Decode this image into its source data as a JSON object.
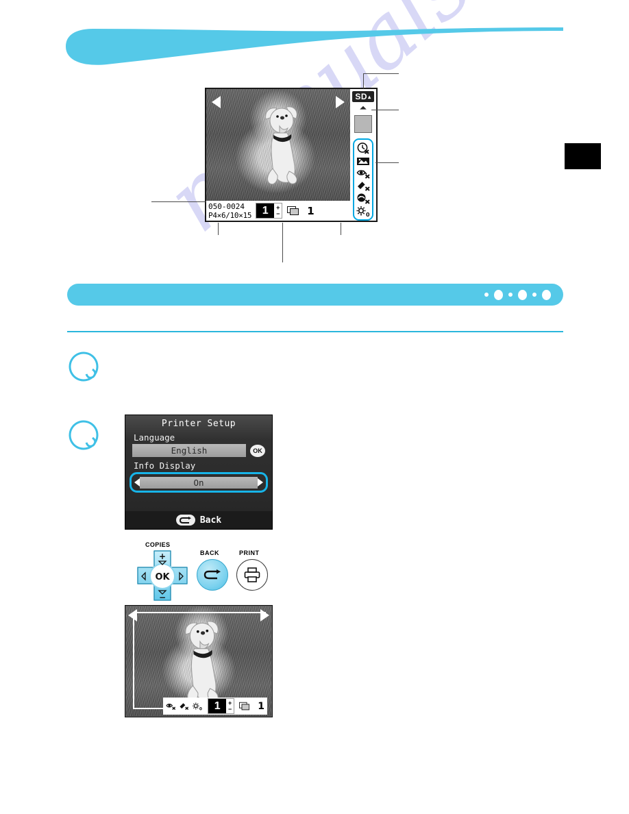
{
  "page": {
    "watermark": "manualshive.com",
    "band_dots": [
      "small",
      "large",
      "small",
      "large",
      "small",
      "large"
    ]
  },
  "lcd_top": {
    "nav_left_icon": "triangle-left-icon",
    "nav_right_icon": "triangle-right-icon",
    "image_id": "050-0024",
    "paper_size": "P4×6/10×15",
    "copies": "1",
    "plus": "+",
    "minus": "−",
    "stack_icon": "print-stack-icon",
    "total_copies": "1",
    "card_badge": "SD",
    "card_badge_mark": "▴",
    "eject_icon": "eject-icon",
    "card_slot_icon": "memory-card-icon",
    "status_icons": [
      {
        "name": "date-print-off-icon",
        "label": "Date print off"
      },
      {
        "name": "image-optimize-icon",
        "label": "Image optimize"
      },
      {
        "name": "red-eye-correction-off-icon",
        "label": "Red-eye correction off"
      },
      {
        "name": "noise-reduction-off-icon",
        "label": "Noise reduction off"
      },
      {
        "name": "face-brighten-off-icon",
        "label": "Face brightener off"
      },
      {
        "name": "brightness-level-icon",
        "label": "Brightness",
        "value": "0"
      }
    ]
  },
  "lcd_menu": {
    "title": "Printer Setup",
    "language_label": "Language",
    "language_value": "English",
    "ok_label": "OK",
    "info_display_label": "Info Display",
    "info_display_value": "On",
    "arrow_left_icon": "triangle-left-icon",
    "arrow_right_icon": "triangle-right-icon",
    "back_label": "Back",
    "back_icon": "return-arrow-icon"
  },
  "buttons": {
    "copies_label": "COPIES",
    "ok_label": "OK",
    "up_plus": "+",
    "down_minus": "−",
    "back_label": "BACK",
    "print_label": "PRINT",
    "back_icon": "return-arrow-icon",
    "print_icon": "printer-icon",
    "dpad_up_icon": "chevron-up-icon",
    "dpad_down_icon": "chevron-down-icon",
    "dpad_left_icon": "chevron-left-icon",
    "dpad_right_icon": "chevron-right-icon"
  },
  "lcd_bottom": {
    "nav_left_icon": "triangle-left-icon",
    "nav_right_icon": "triangle-right-icon",
    "copies": "1",
    "plus": "+",
    "minus": "−",
    "total_copies": "1",
    "stack_icon": "print-stack-icon",
    "status_icons": [
      {
        "name": "red-eye-correction-off-icon",
        "label": "Red-eye correction off"
      },
      {
        "name": "noise-reduction-off-icon",
        "label": "Noise reduction off"
      },
      {
        "name": "brightness-level-icon",
        "label": "Brightness",
        "value": "0"
      }
    ]
  },
  "colors": {
    "accent": "#55c9e8",
    "rule": "#2ab6dc",
    "highlight": "#17b4e8",
    "tab": "#000000",
    "watermark": "#b9b9ef"
  }
}
